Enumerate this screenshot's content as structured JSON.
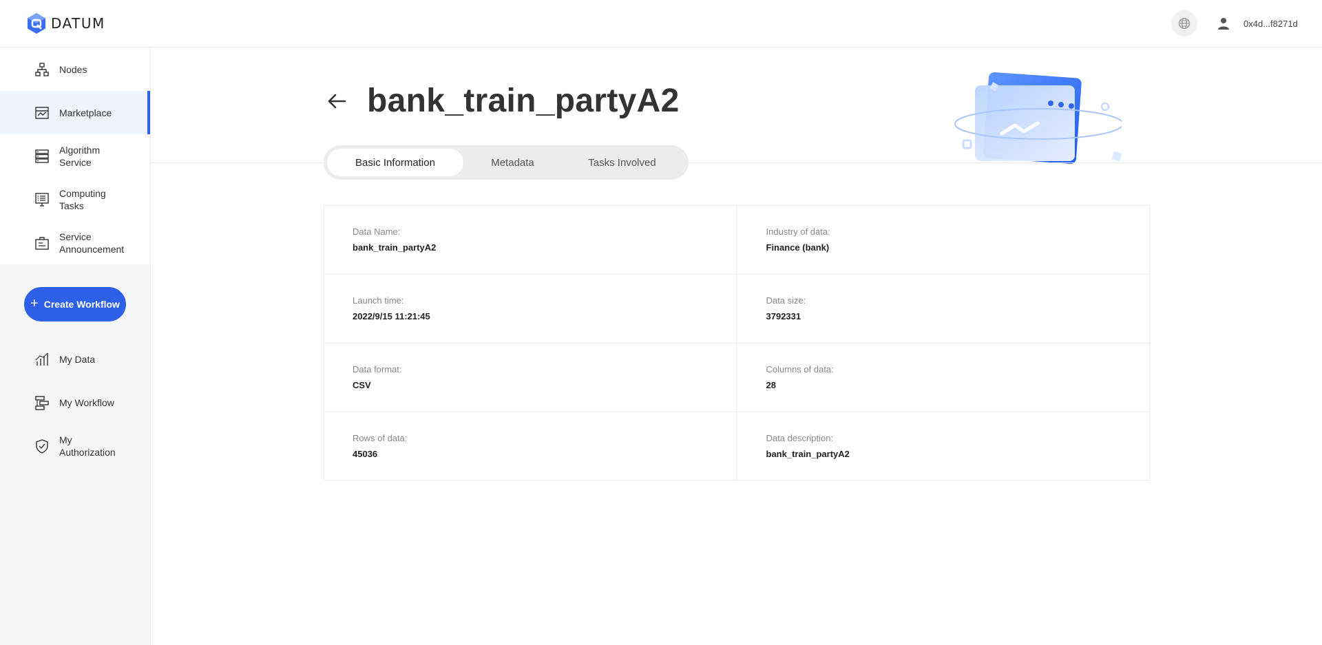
{
  "header": {
    "logo_text": "DATUM",
    "address": "0x4d...f8271d",
    "icons": {
      "globe": "globe-icon",
      "user": "user-icon"
    }
  },
  "sidebar": {
    "items": [
      {
        "label": "Nodes",
        "icon": "nodes-icon"
      },
      {
        "label": "Marketplace",
        "icon": "marketplace-icon",
        "active": true
      },
      {
        "label": "Algorithm Service",
        "icon": "algorithm-icon"
      },
      {
        "label": "Computing Tasks",
        "icon": "computing-tasks-icon"
      },
      {
        "label": "Service Announcement",
        "icon": "announcement-icon"
      }
    ],
    "create_label": "Create Workflow",
    "lower_items": [
      {
        "label": "My Data",
        "icon": "my-data-icon"
      },
      {
        "label": "My Workflow",
        "icon": "my-workflow-icon"
      },
      {
        "label": "My Authorization",
        "icon": "authorization-icon"
      }
    ]
  },
  "main": {
    "title": "bank_train_partyA2",
    "tabs": [
      {
        "label": "Basic Information",
        "active": true
      },
      {
        "label": "Metadata"
      },
      {
        "label": "Tasks Involved"
      }
    ],
    "info": [
      [
        {
          "key": "Data Name:",
          "value": "bank_train_partyA2"
        },
        {
          "key": "Industry of data:",
          "value": "Finance (bank)"
        }
      ],
      [
        {
          "key": "Launch time:",
          "value": "2022/9/15 11:21:45"
        },
        {
          "key": "Data size:",
          "value": "3792331"
        }
      ],
      [
        {
          "key": "Data format:",
          "value": "CSV"
        },
        {
          "key": "Columns of data:",
          "value": "28"
        }
      ],
      [
        {
          "key": "Rows of data:",
          "value": "45036"
        },
        {
          "key": "Data description:",
          "value": "bank_train_partyA2"
        }
      ]
    ]
  },
  "colors": {
    "accent": "#2d5fe8",
    "active_bg": "#eef3fd"
  }
}
